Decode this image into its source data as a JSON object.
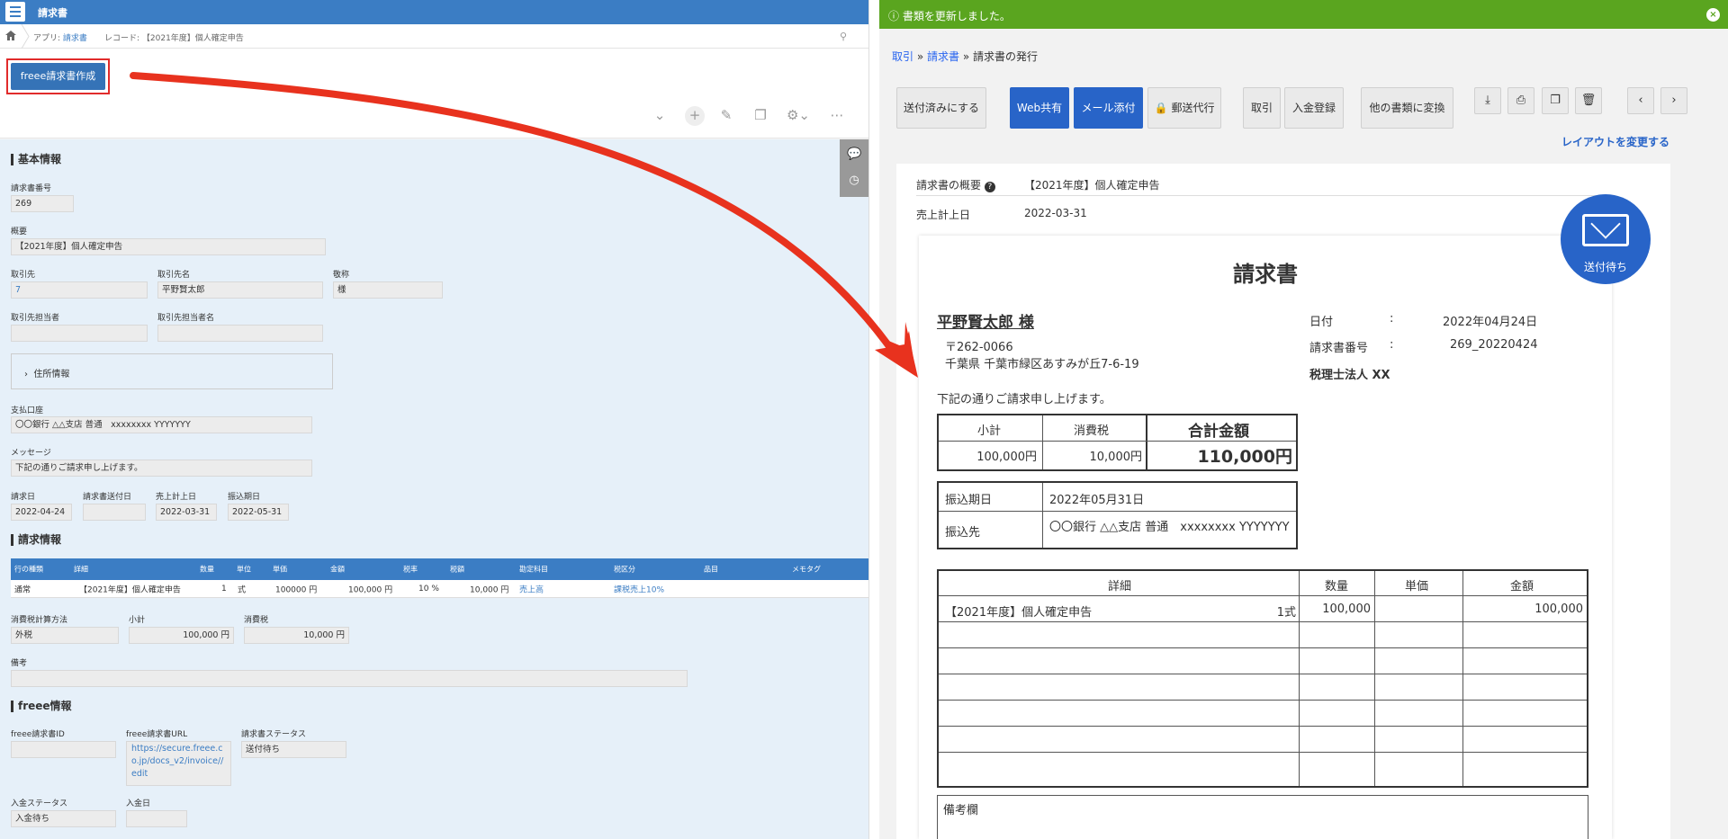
{
  "left": {
    "app_title": "請求書",
    "breadcrumb": {
      "app_prefix": "アプリ: ",
      "app_link": "請求書",
      "record": "レコード: 【2021年度】個人確定申告"
    },
    "freee_button": "freee請求書作成",
    "sections": {
      "basic": "基本情報",
      "invoice": "請求情報",
      "freee": "freee情報"
    },
    "fields": {
      "invoice_no": {
        "label": "請求書番号",
        "value": "269"
      },
      "summary": {
        "label": "概要",
        "value": "【2021年度】個人確定申告"
      },
      "partner": {
        "label": "取引先",
        "value": "7"
      },
      "partner_name": {
        "label": "取引先名",
        "value": "平野賢太郎"
      },
      "honorific": {
        "label": "敬称",
        "value": "様"
      },
      "contact": {
        "label": "取引先担当者",
        "value": ""
      },
      "contact_name": {
        "label": "取引先担当者名",
        "value": ""
      },
      "address_section": "住所情報",
      "bank": {
        "label": "支払口座",
        "value": "〇〇銀行 △△支店 普通　xxxxxxxx YYYYYYY"
      },
      "message": {
        "label": "メッセージ",
        "value": "下記の通りご請求申し上げます。"
      },
      "invoice_date": {
        "label": "請求日",
        "value": "2022-04-24"
      },
      "sent_date": {
        "label": "請求書送付日",
        "value": ""
      },
      "sales_date": {
        "label": "売上計上日",
        "value": "2022-03-31"
      },
      "due_date": {
        "label": "振込期日",
        "value": "2022-05-31"
      },
      "tax_method": {
        "label": "消費税計算方法",
        "value": "外税"
      },
      "subtotal": {
        "label": "小計",
        "value": "100,000 円"
      },
      "tax": {
        "label": "消費税",
        "value": "10,000 円"
      },
      "notes": {
        "label": "備考",
        "value": ""
      },
      "freee_id": {
        "label": "freee請求書ID",
        "value": ""
      },
      "freee_url": {
        "label": "freee請求書URL",
        "value": "https://secure.freee.co.jp/docs_v2/invoice//edit"
      },
      "status": {
        "label": "請求書ステータス",
        "value": "送付待ち"
      },
      "payment_status": {
        "label": "入金ステータス",
        "value": "入金待ち"
      },
      "payment_date": {
        "label": "入金日",
        "value": ""
      }
    },
    "table": {
      "headers": [
        "行の種類",
        "詳細",
        "数量",
        "単位",
        "単価",
        "金額",
        "税率",
        "税額",
        "勘定科目",
        "税区分",
        "品目",
        "メモタグ"
      ],
      "row": [
        "通常",
        "【2021年度】個人確定申告",
        "1",
        "式",
        "100000 円",
        "100,000 円",
        "10 %",
        "10,000 円",
        "売上高",
        "課税売上10%",
        "",
        ""
      ]
    }
  },
  "right": {
    "banner": "書類を更新しました。",
    "breadcrumb": {
      "item1": "取引",
      "item2": "請求書",
      "current": "請求書の発行",
      "sep": "»"
    },
    "buttons": {
      "mark_sent": "送付済みにする",
      "web_share": "Web共有",
      "mail_attach": "メール添付",
      "postal": "郵送代行",
      "deal": "取引",
      "payment": "入金登録",
      "convert": "他の書類に変換"
    },
    "change_layout": "レイアウトを変更する",
    "summary": {
      "label": "請求書の概要",
      "value": "【2021年度】個人確定申告",
      "sales_label": "売上計上日",
      "sales_value": "2022-03-31"
    },
    "stamp_label": "送付待ち",
    "paper": {
      "title": "請求書",
      "recipient": "平野賢太郎 様",
      "postal": "〒262-0066",
      "address": "千葉県 千葉市緑区あすみが丘7-6-19",
      "date_label": "日付",
      "date_value": "2022年04月24日",
      "number_label": "請求書番号",
      "number_value": "269_20220424",
      "colon": ":",
      "issuer": "税理士法人 XX",
      "message": "下記の通りご請求申し上げます。",
      "totals": {
        "subtotal_h": "小計",
        "tax_h": "消費税",
        "total_h": "合計金額",
        "subtotal": "100,000円",
        "tax": "10,000円",
        "total": "110,000円"
      },
      "payment": {
        "due_label": "振込期日",
        "due_value": "2022年05月31日",
        "bank_label": "振込先",
        "bank_value": "〇〇銀行 △△支店 普通　xxxxxxxx YYYYYYY"
      },
      "lines": {
        "headers": [
          "詳細",
          "数量",
          "単価",
          "金額"
        ],
        "row": [
          "【2021年度】個人確定申告",
          "1式",
          "100,000",
          "100,000"
        ]
      },
      "remarks": "備考欄"
    }
  }
}
